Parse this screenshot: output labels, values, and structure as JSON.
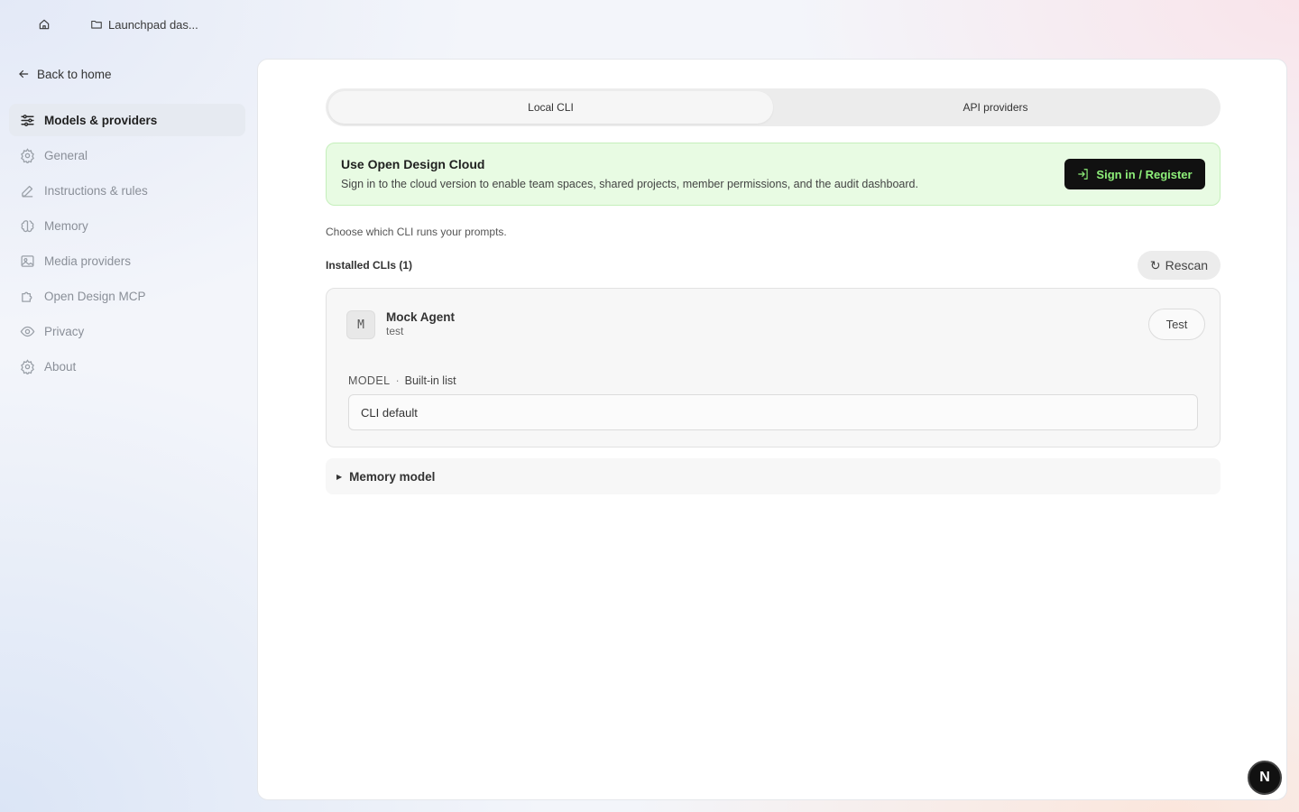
{
  "topbar": {
    "home_icon": "home-icon",
    "breadcrumb": "Launchpad das..."
  },
  "sidebar": {
    "back_label": "Back to home",
    "items": [
      {
        "label": "Models & providers",
        "icon": "sliders-icon",
        "active": true
      },
      {
        "label": "General",
        "icon": "gear-icon",
        "active": false
      },
      {
        "label": "Instructions & rules",
        "icon": "pencil-icon",
        "active": false
      },
      {
        "label": "Memory",
        "icon": "brain-icon",
        "active": false
      },
      {
        "label": "Media providers",
        "icon": "image-icon",
        "active": false
      },
      {
        "label": "Open Design MCP",
        "icon": "puzzle-icon",
        "active": false
      },
      {
        "label": "Privacy",
        "icon": "eye-icon",
        "active": false
      },
      {
        "label": "About",
        "icon": "gear-icon",
        "active": false
      }
    ]
  },
  "main": {
    "tabs": [
      {
        "label": "Local CLI",
        "active": true
      },
      {
        "label": "API providers",
        "active": false
      }
    ],
    "cloud": {
      "title": "Use Open Design Cloud",
      "description": "Sign in to the cloud version to enable team spaces, shared projects, member permissions, and the audit dashboard.",
      "button_label": "Sign in / Register"
    },
    "choose_text": "Choose which CLI runs your prompts.",
    "installed_label": "Installed CLIs (1)",
    "rescan_label": "Rescan",
    "cli": {
      "avatar": "M",
      "name": "Mock Agent",
      "subtitle": "test",
      "test_label": "Test",
      "model_label": "MODEL",
      "model_separator": "·",
      "model_source": "Built-in list",
      "model_value": "CLI default"
    },
    "memory_label": "Memory model"
  },
  "fab": {
    "label": "N"
  },
  "colors": {
    "accent_green": "#8ef07a",
    "cloud_bg": "#e8fbe3",
    "active_nav_bg": "#e6eaf1"
  }
}
